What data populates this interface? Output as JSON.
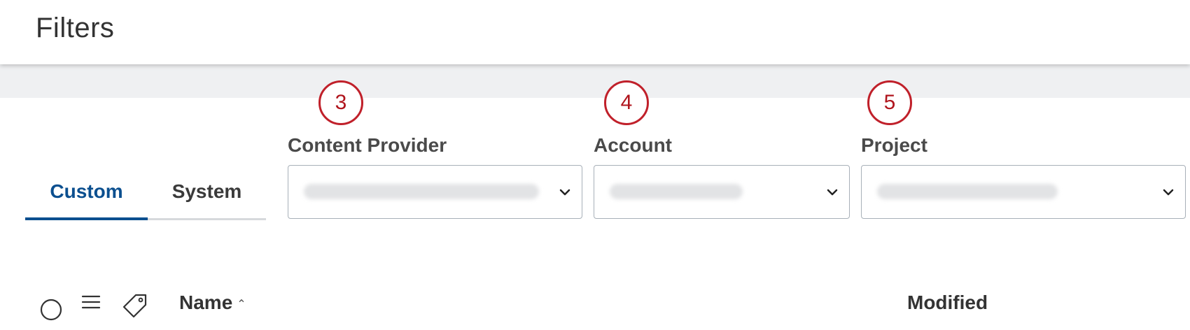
{
  "header": {
    "title": "Filters"
  },
  "callouts": [
    "3",
    "4",
    "5"
  ],
  "tabs": [
    {
      "label": "Custom",
      "active": true
    },
    {
      "label": "System",
      "active": false
    }
  ],
  "filters": {
    "content_provider": {
      "label": "Content Provider",
      "value": "",
      "value_obscured": true
    },
    "account": {
      "label": "Account",
      "value": "",
      "value_obscured": true
    },
    "project": {
      "label": "Project",
      "value": "",
      "value_obscured": true
    }
  },
  "table": {
    "columns": {
      "name": "Name",
      "modified": "Modified"
    },
    "icons": [
      "select-all-circle-icon",
      "list-icon",
      "tag-icon"
    ]
  },
  "colors": {
    "accent": "#0b4f8f",
    "callout": "#c0202a",
    "subbar": "#eff0f2"
  }
}
